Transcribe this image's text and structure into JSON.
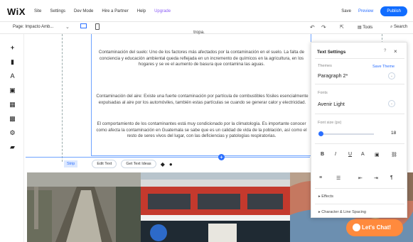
{
  "topbar": {
    "logo": "WiX",
    "menu": [
      "Site",
      "Settings",
      "Dev Mode",
      "Hire a Partner",
      "Help",
      "Upgrade"
    ],
    "save_label": "Save",
    "preview_label": "Preview",
    "publish_label": "Publish"
  },
  "subbar": {
    "page_select": "Page: Impacto Amb...",
    "tools_label": "Tools",
    "search_label": "Search"
  },
  "canvas": {
    "page_top_fragment": "tropa.",
    "paragraph_1": "Contaminación del suelo: Uno de los factores más afectados por la contaminación en el suelo. La falta de conciencia y educación ambiental queda reflejada en un incremento de químicos en la agricultura, en los hogares y se ve el aumento de basura que contamina las aguas.",
    "paragraph_2": "Contaminación del aire: Existe una fuerte contaminación por partícula de combustibles fósiles esencialmente expulsadas al aire por los automóviles, también estas partículas se cuando se generar calor y electricidad.",
    "paragraph_3": "El comportamiento de los contaminantes está muy condicionado por la climatología. Es importante conocer como afecta la contaminación en Guatemala se sabe que es un calidad de vida de la población, así como el resto de seres vivos del lugar, con las deficiencias y patologías respiratorias.",
    "strip_label": "Strip",
    "edit_text": "Edit Text",
    "get_text_ideas": "Get Text Ideas"
  },
  "text_settings": {
    "title": "Text Settings",
    "help": "?",
    "close": "×",
    "themes_label": "Themes",
    "save_theme": "Save Theme",
    "theme_value": "Paragraph 2*",
    "fonts_label": "Fonts",
    "font_value": "Avenir Light",
    "font_size_label": "Font size (px)",
    "font_size_value": "18",
    "effects_label": "Effects",
    "spacing_label": "Character & Line Spacing"
  },
  "chat": {
    "label": "Let's Chat!"
  },
  "colors": {
    "accent": "#116dff",
    "chat": "#ff8a3d"
  }
}
